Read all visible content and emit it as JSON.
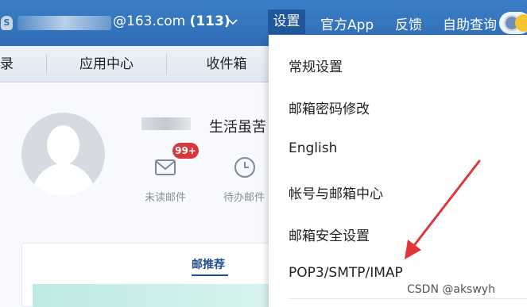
{
  "topbar": {
    "account_icon_letter": "S",
    "account_email": "@163.com",
    "account_count": "(113)",
    "nav": {
      "settings": "设置",
      "official_app": "官方App",
      "feedback": "反馈",
      "self_service": "自助查询"
    }
  },
  "subnav": {
    "items": [
      "录",
      "应用中心",
      "收件箱"
    ]
  },
  "profile": {
    "name": "生活虽苦",
    "unread_badge": "99+",
    "unread_label": "未读邮件",
    "todo_label": "待办邮件"
  },
  "card": {
    "tab": "邮推荐"
  },
  "settings_menu": {
    "items": [
      "常规设置",
      "邮箱密码修改",
      "English",
      "帐号与邮箱中心",
      "邮箱安全设置",
      "POP3/SMTP/IMAP"
    ]
  },
  "watermark": "CSDN @akswyh",
  "colors": {
    "topbar": "#2f6db6",
    "settings_active": "#1f579a",
    "badge": "#d9363e",
    "arrow": "#e0353a"
  },
  "icons": [
    "account-shield-icon",
    "chevron-down-icon",
    "user-circle-icon",
    "mail-icon",
    "clock-icon",
    "annotation-arrow"
  ]
}
